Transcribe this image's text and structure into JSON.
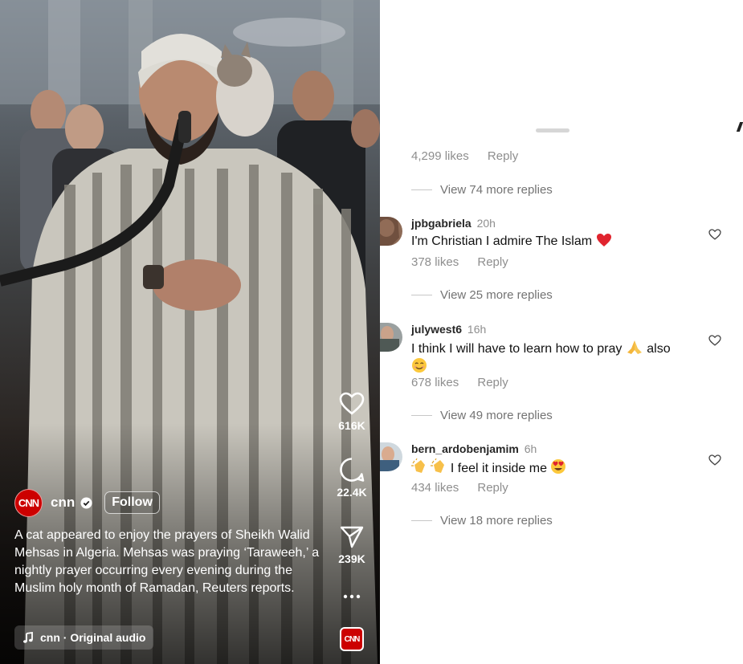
{
  "reel": {
    "owner": {
      "name": "cnn",
      "logo_text": "CNN",
      "verified": true
    },
    "follow_label": "Follow",
    "caption": "A cat appeared to enjoy the prayers of Sheikh Walid Mehsas in Algeria. Mehsas was praying ‘Taraweeh,’ a nightly prayer occurring every evening during the Muslim holy month of Ramadan, Reuters reports.",
    "audio_label": "cnn · Original audio",
    "audio_thumb_text": "CNN",
    "actions": {
      "likes": "616K",
      "comments": "22.4K",
      "shares": "239K",
      "more_icon": "more-dots-icon"
    },
    "brand_color": "#cc0000"
  },
  "comments_panel": {
    "top_meta": {
      "likes": "4,299 likes",
      "reply": "Reply"
    },
    "top_view_more": "View 74 more replies",
    "comments": [
      {
        "username": "jpbgabriela",
        "time": "20h",
        "text": "I'm Christian I admire The Islam",
        "emoji": "red-heart",
        "likes": "378 likes",
        "reply": "Reply",
        "view_more": "View 25 more replies"
      },
      {
        "username": "julywest6",
        "time": "16h",
        "text_before": "I think I will have to learn how to pray",
        "text_after": "also",
        "emojis": [
          "folded-hands",
          "smiling-face"
        ],
        "likes": "678 likes",
        "reply": "Reply",
        "view_more": "View 49 more replies"
      },
      {
        "username": "bern_ardobenjamim",
        "time": "6h",
        "text": "I feel it inside me",
        "emojis": [
          "clapping-hands",
          "clapping-hands",
          "heart-eyes"
        ],
        "likes": "434 likes",
        "reply": "Reply",
        "view_more": "View 18 more replies"
      }
    ]
  }
}
